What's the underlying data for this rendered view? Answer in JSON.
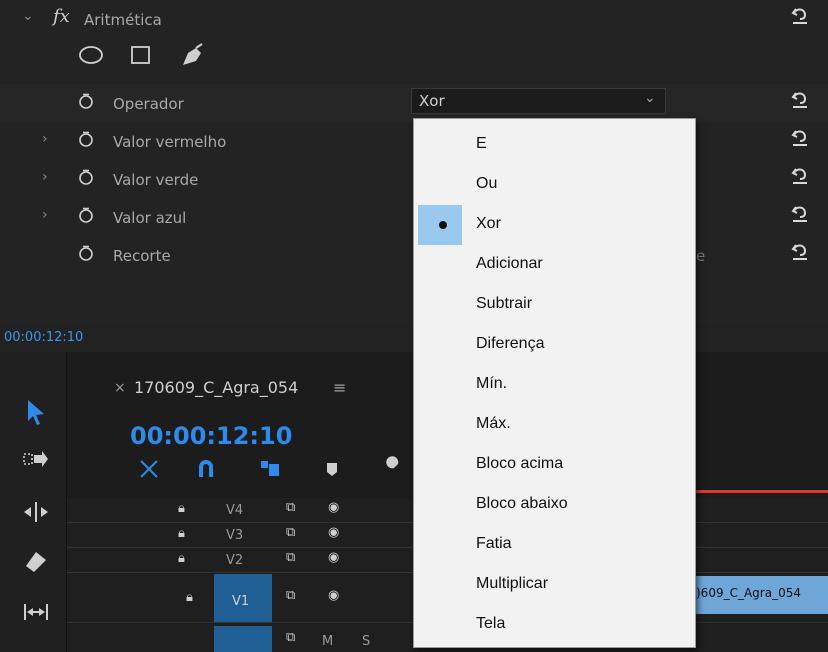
{
  "effect": {
    "name": "Aritmética",
    "fx_symbol": "fx"
  },
  "params": [
    {
      "label": "Operador",
      "expandable": false
    },
    {
      "label": "Valor vermelho",
      "expandable": true
    },
    {
      "label": "Valor verde",
      "expandable": true
    },
    {
      "label": "Valor azul",
      "expandable": true
    },
    {
      "label": "Recorte",
      "expandable": false
    }
  ],
  "operator_select": {
    "value": "Xor"
  },
  "clipping_partial_text": "e",
  "timecode_top": "00:00:12:10",
  "sequence": {
    "close_glyph": "×",
    "name": "170609_C_Agra_054",
    "menu_glyph": "≡",
    "timecode": "00:00:12:10"
  },
  "tracks": [
    {
      "label": "V4"
    },
    {
      "label": "V3"
    },
    {
      "label": "V2"
    },
    {
      "label": "V1"
    }
  ],
  "track_audio_letters": {
    "m": "M",
    "s": "S"
  },
  "clip": {
    "label": ")609_C_Agra_054"
  },
  "menu": {
    "selected_index": 2,
    "items": [
      "E",
      "Ou",
      "Xor",
      "Adicionar",
      "Subtrair",
      "Diferença",
      "Mín.",
      "Máx.",
      "Bloco acima",
      "Bloco abaixo",
      "Fatia",
      "Multiplicar",
      "Tela"
    ]
  },
  "colors": {
    "accent_blue": "#2d8ceb",
    "selection": "#99c9ef",
    "playhead_red": "#e03a2e",
    "clip_blue": "#6fa6d8"
  }
}
